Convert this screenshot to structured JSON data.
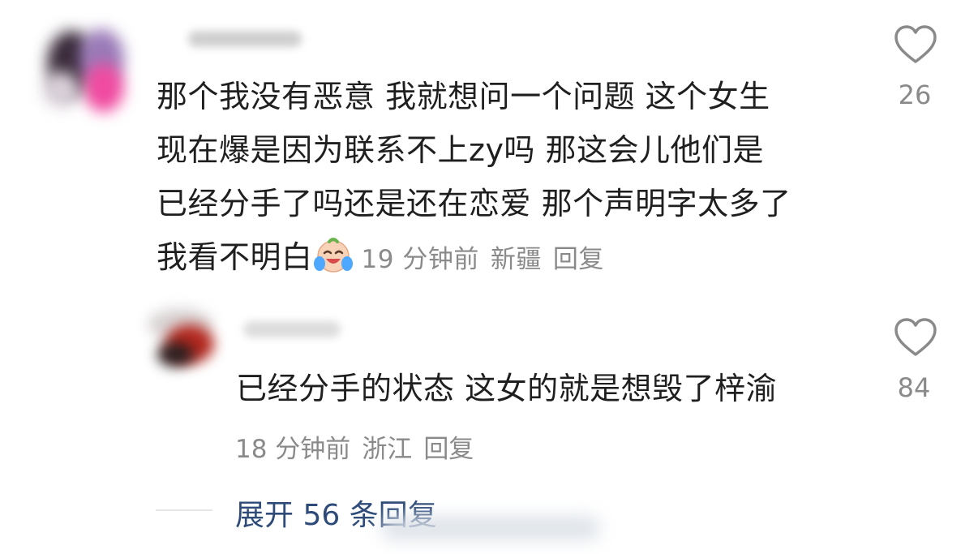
{
  "comments": [
    {
      "text_lines": [
        "那个我没有恶意 我就想问一个问题 这个女生",
        "现在爆是因为联系不上zy吗 那这会儿他们是",
        "已经分手了吗还是还在恋爱 那个声明字太多了",
        "我看不明白"
      ],
      "emoji": "crying-laughing-emoji",
      "time": "19 分钟前",
      "location": "新疆",
      "reply_label": "回复",
      "likes": "26"
    },
    {
      "text_lines": [
        "已经分手的状态  这女的就是想毁了梓渝"
      ],
      "time": "18 分钟前",
      "location": "浙江",
      "reply_label": "回复",
      "likes": "84"
    }
  ],
  "expand_replies": {
    "label": "展开 56 条回复"
  },
  "icons": {
    "like": "heart-outline-icon"
  },
  "colors": {
    "text": "#1f1f1f",
    "meta": "#8a8a8a",
    "link": "#2d4a78"
  }
}
